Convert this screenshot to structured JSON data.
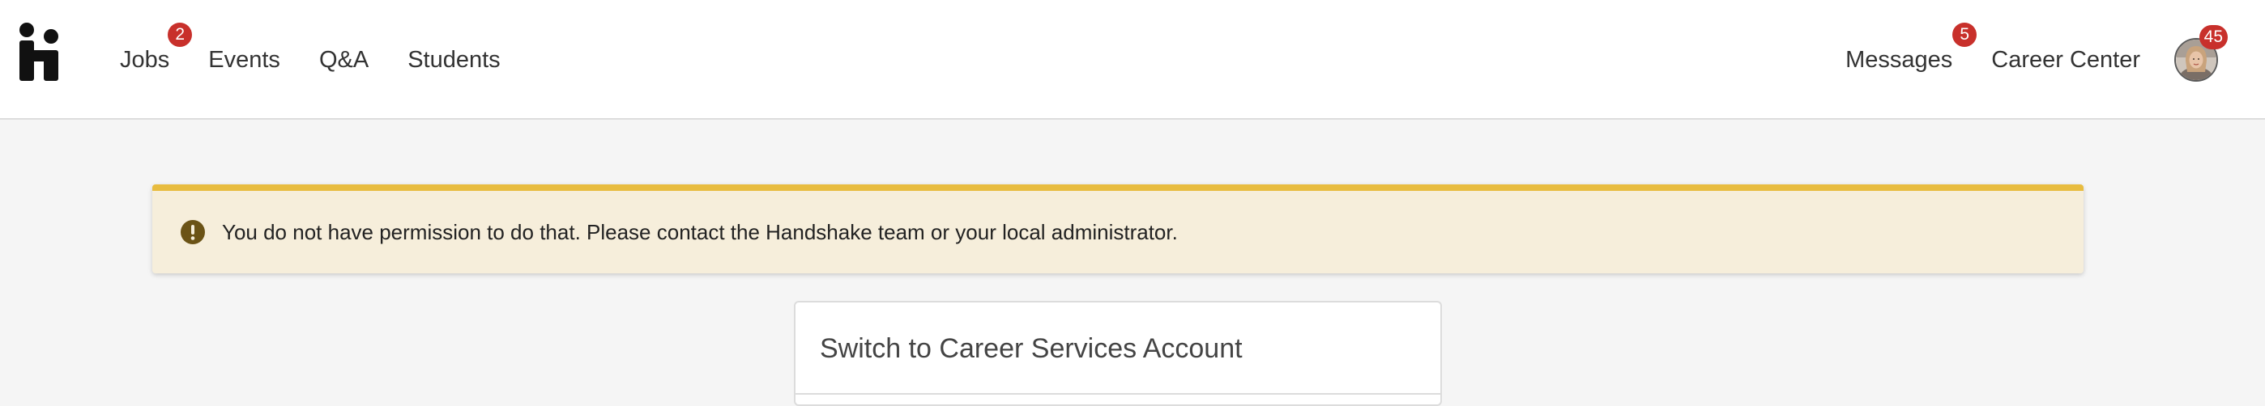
{
  "nav": {
    "left_items": [
      {
        "label": "Jobs",
        "badge": "2"
      },
      {
        "label": "Events"
      },
      {
        "label": "Q&A"
      },
      {
        "label": "Students"
      }
    ],
    "right_items": [
      {
        "label": "Messages",
        "badge": "5"
      },
      {
        "label": "Career Center"
      }
    ],
    "avatar_badge": "45"
  },
  "alert": {
    "message": "You do not have permission to do that. Please contact the Handshake team or your local administrator.",
    "icon": "exclamation-circle-icon",
    "accent_color": "#e8bc3f",
    "background_color": "#f6eedb"
  },
  "card": {
    "title": "Switch to Career Services Account"
  },
  "colors": {
    "badge": "#c8302b",
    "page_background": "#f5f5f5"
  }
}
